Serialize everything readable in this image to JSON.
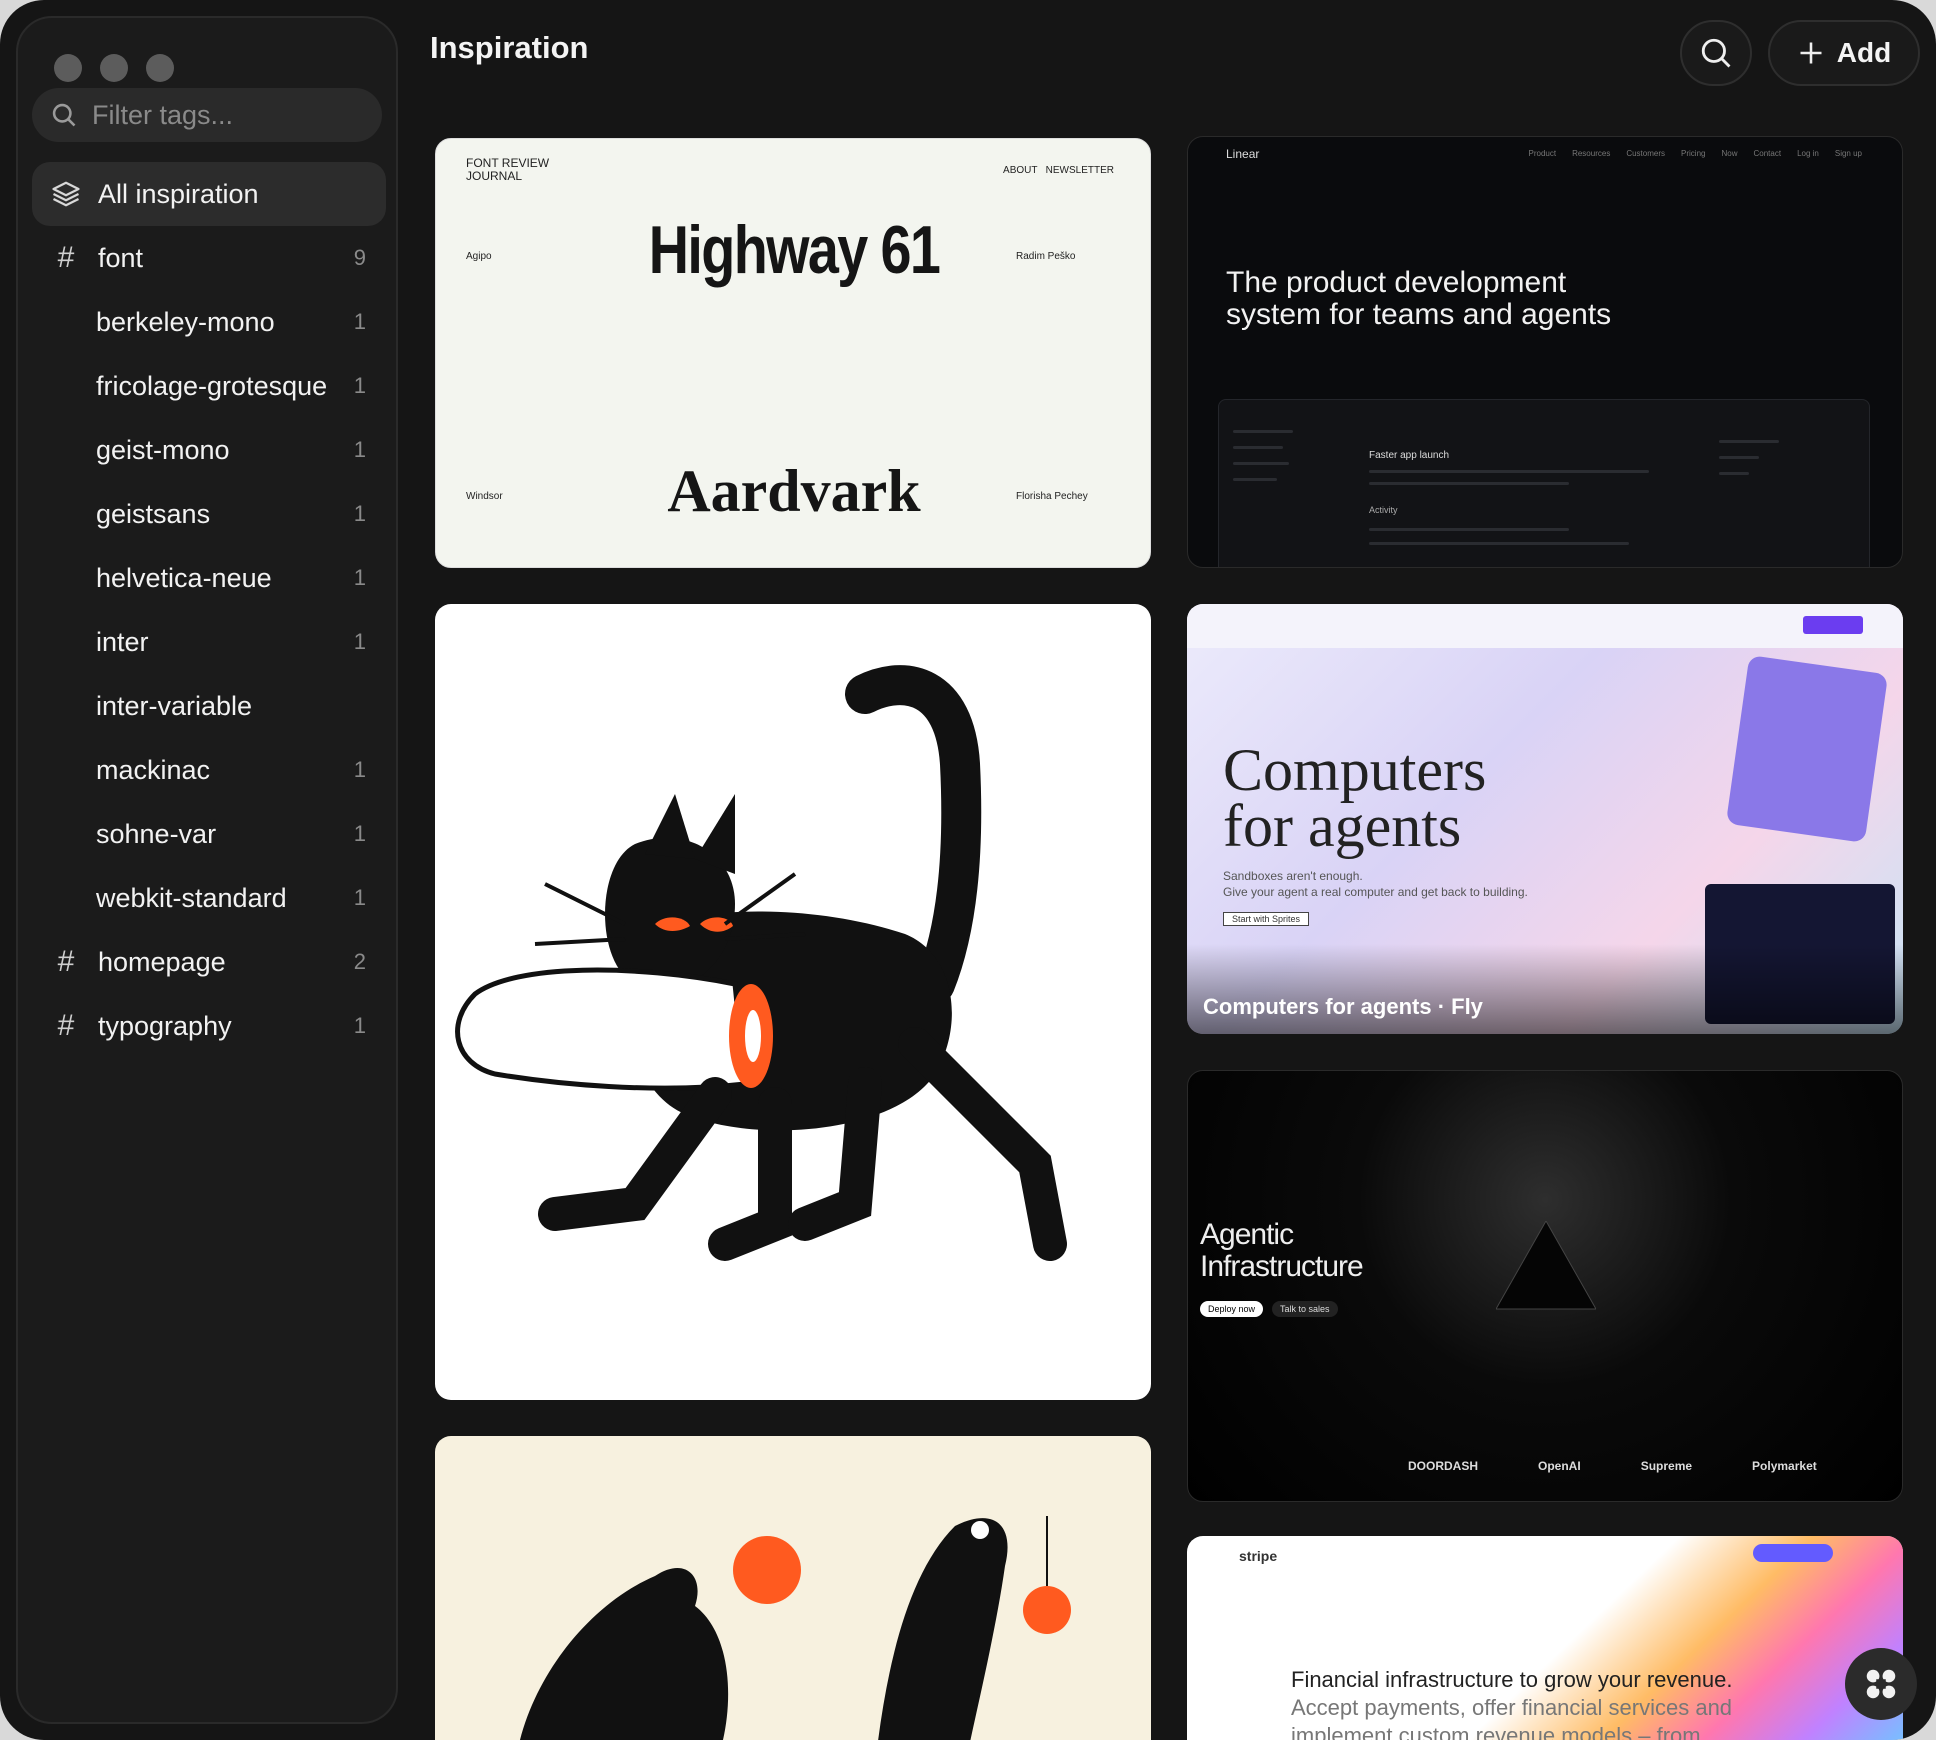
{
  "header": {
    "title": "Inspiration",
    "add_label": "Add"
  },
  "sidebar": {
    "filter_placeholder": "Filter tags...",
    "items": [
      {
        "label": "All inspiration",
        "count": "",
        "kind": "all",
        "icon": "layers-icon"
      },
      {
        "label": "font",
        "count": "9",
        "kind": "tag",
        "icon": "hash-icon"
      },
      {
        "label": "berkeley-mono",
        "count": "1",
        "kind": "child"
      },
      {
        "label": "fricolage-grotesque",
        "count": "1",
        "kind": "child"
      },
      {
        "label": "geist-mono",
        "count": "1",
        "kind": "child"
      },
      {
        "label": "geistsans",
        "count": "1",
        "kind": "child"
      },
      {
        "label": "helvetica-neue",
        "count": "1",
        "kind": "child"
      },
      {
        "label": "inter",
        "count": "1",
        "kind": "child"
      },
      {
        "label": "inter-variable",
        "count": "",
        "kind": "child"
      },
      {
        "label": "mackinac",
        "count": "1",
        "kind": "child"
      },
      {
        "label": "sohne-var",
        "count": "1",
        "kind": "child"
      },
      {
        "label": "webkit-standard",
        "count": "1",
        "kind": "child"
      },
      {
        "label": "homepage",
        "count": "2",
        "kind": "tag",
        "icon": "hash-icon"
      },
      {
        "label": "typography",
        "count": "1",
        "kind": "tag",
        "icon": "hash-icon"
      }
    ]
  },
  "cards": {
    "font_review": {
      "journal": "FONT REVIEW\nJOURNAL",
      "nav": "ABOUT   NEWSLETTER",
      "left1": "Agipo",
      "right1": "Radim Peško",
      "headline1": "Highway 61",
      "left2": "Windsor",
      "right2": "Florisha Pechey",
      "headline2": "Aardvark"
    },
    "linear": {
      "logo": "Linear",
      "nav": [
        "Product",
        "Resources",
        "Customers",
        "Pricing",
        "Now",
        "Contact",
        "Log in",
        "Sign up"
      ],
      "headline": "The product development\nsystem for teams and agents",
      "app_title": "Faster app launch",
      "app_section": "Activity"
    },
    "fly": {
      "headline": "Computers\nfor agents",
      "sub": "Sandboxes aren't enough.\nGive your agent a real computer and get back to building.",
      "cta": "Start with Sprites",
      "caption": "Computers for agents · Fly"
    },
    "agentic": {
      "headline": "Agentic\nInfrastructure",
      "deploy": "Deploy now",
      "talk": "Talk to sales",
      "logos": [
        "DOORDASH",
        "OpenAI",
        "Supreme",
        "Polymarket"
      ]
    },
    "stripe": {
      "logo": "stripe",
      "headline": "Financial infrastructure to grow your revenue.",
      "sub": "Accept payments, offer financial services and implement custom revenue models – from"
    }
  },
  "colors": {
    "window_bg": "#151515",
    "sidebar_bg": "#1b1b1b",
    "accent_orange": "#ff5a1f"
  }
}
